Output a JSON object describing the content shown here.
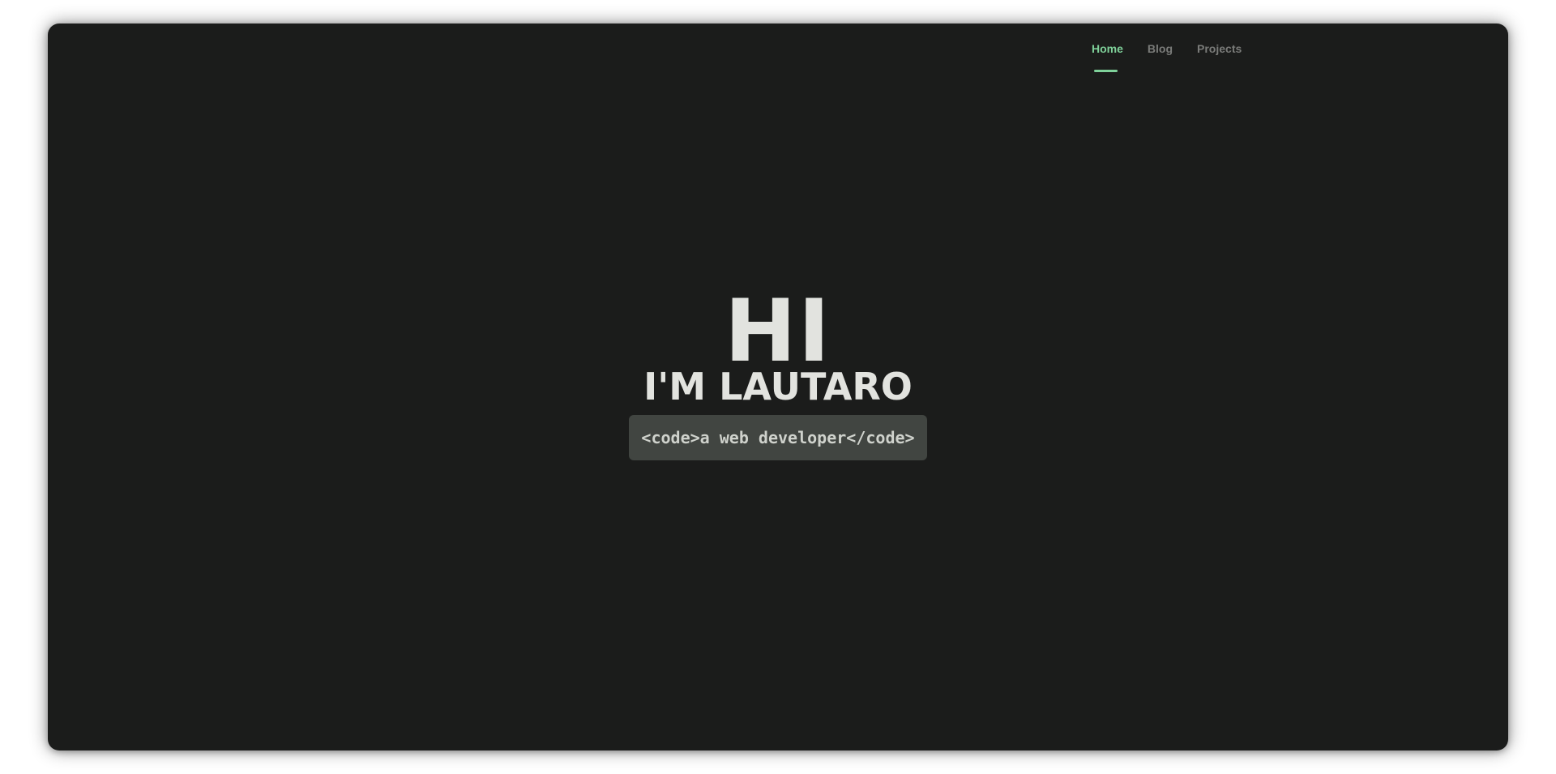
{
  "nav": {
    "items": [
      {
        "label": "Home",
        "active": true
      },
      {
        "label": "Blog",
        "active": false
      },
      {
        "label": "Projects",
        "active": false
      }
    ]
  },
  "hero": {
    "greeting": "HI",
    "name": "I'M LAUTARO",
    "tagline": "<code>a web developer</code>"
  },
  "colors": {
    "background": "#1b1c1b",
    "accent": "#7fd19a",
    "text": "#e2e3df",
    "nav_inactive": "#7a7b79",
    "pill_bg": "#414541"
  }
}
